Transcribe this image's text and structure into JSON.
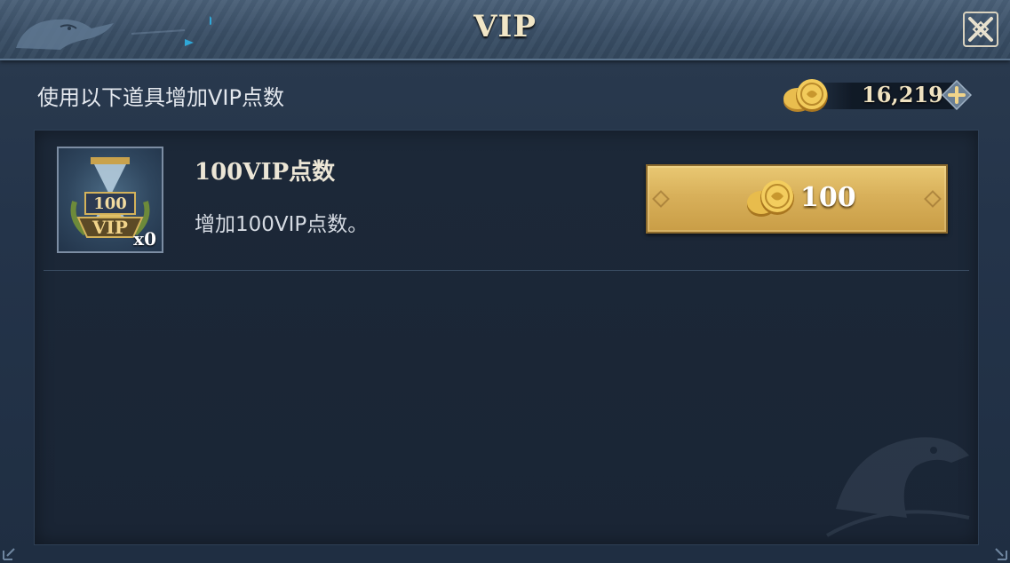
{
  "window": {
    "title": "VIP"
  },
  "header": {
    "label": "使用以下道具增加VIP点数",
    "currency_value": "16,219"
  },
  "items": [
    {
      "title": "100VIP点数",
      "description": "增加100VIP点数。",
      "count": "x0",
      "icon_label": "100",
      "icon_badge": "VIP",
      "price": "100"
    }
  ],
  "colors": {
    "accent_gold": "#d8b05a",
    "title_text": "#f1e6c6",
    "panel_bg": "#1c2838"
  },
  "icons": {
    "close": "close-x-icon",
    "currency": "gold-coin-icon",
    "add": "plus-icon"
  }
}
